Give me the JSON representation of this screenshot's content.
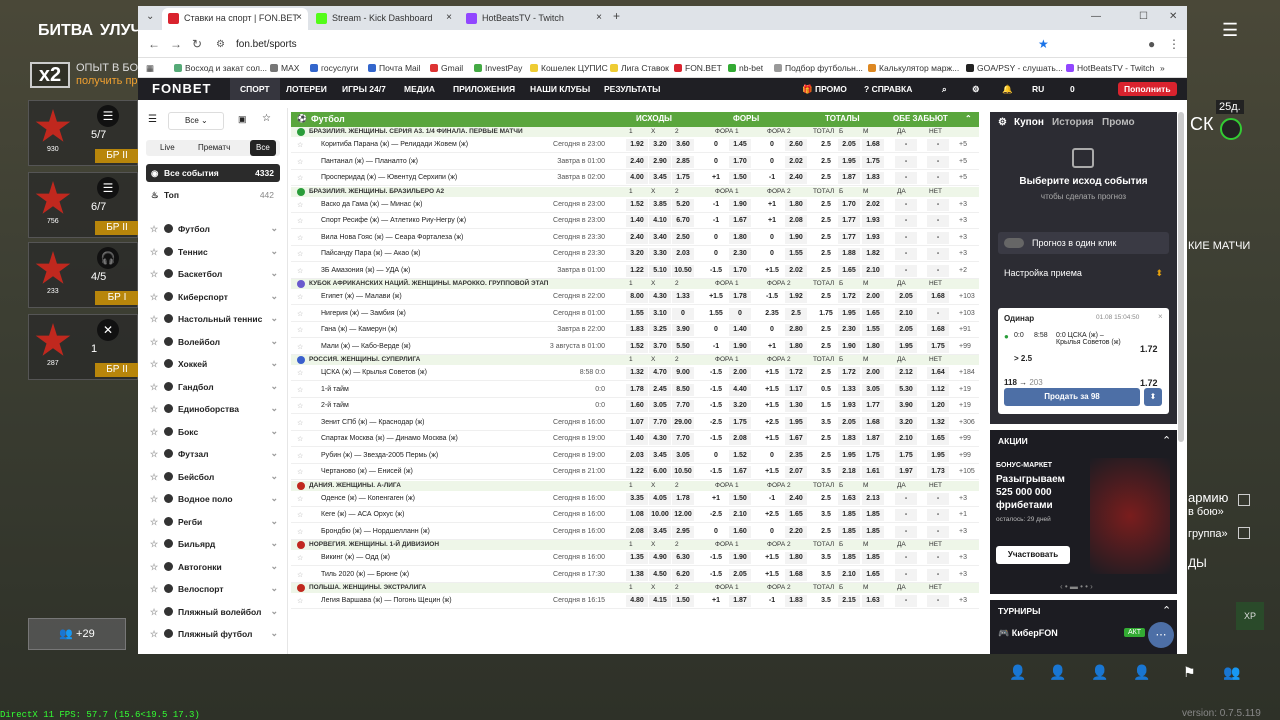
{
  "game": {
    "tab1": "БИТВА",
    "tab2": "УЛУЧ",
    "multiplier": "x2",
    "exp_line1": "ОПЫТ В БОЯ",
    "exp_line2": "получить про",
    "cards": [
      {
        "count": "5/7",
        "num": "930",
        "rank": "БР II",
        "icon": "☰"
      },
      {
        "count": "6/7",
        "num": "756",
        "rank": "БР II",
        "icon": "☰"
      },
      {
        "count": "4/5",
        "num": "233",
        "rank": "БР I",
        "icon": "🎧"
      },
      {
        "count": "1",
        "num": "287",
        "rank": "БР II",
        "icon": "✕"
      }
    ],
    "group": "+29",
    "fps": "DirectX 11 FPS: 57.7 (15.6<19.5 17.3)",
    "right": {
      "days": "25д.",
      "lbl1": "СК",
      "lbl2": "КИЕ МАТЧИ",
      "lbl3": "армию",
      "lbl4": "в бою»",
      "lbl5": "группа»",
      "lbl6": "ДЫ"
    },
    "version": "version: 0.7.5.119"
  },
  "browser": {
    "tabs": [
      "Ставки на спорт | FON.BET",
      "Stream - Kick Dashboard",
      "HotBeatsTV - Twitch"
    ],
    "url": "fon.bet/sports",
    "bookmarks": [
      "Восход и закат сол...",
      "MAX",
      "госуслуги",
      "Почта Mail",
      "Gmail",
      "InvestPay",
      "Кошелек ЦУПИС",
      "Лига Ставок",
      "FON.BET",
      "nb-bet",
      "Подбор футбольн...",
      "Калькулятор марж...",
      "GOA/PSY - слушать...",
      "HotBeatsTV - Twitch"
    ]
  },
  "fonbet": {
    "logo": "FONBET",
    "nav": [
      "СПОРТ",
      "ЛОТЕРЕИ",
      "ИГРЫ 24/7",
      "МЕДИА",
      "ПРИЛОЖЕНИЯ",
      "НАШИ КЛУБЫ",
      "РЕЗУЛЬТАТЫ"
    ],
    "promo": "ПРОМО",
    "help": "СПРАВКА",
    "lang": "RU",
    "balance": "0",
    "deposit": "Пополнить",
    "filter": "Все",
    "seg": [
      "Live",
      "Прематч",
      "Все"
    ],
    "all_events": "Все события",
    "all_count": "4332",
    "top": "Топ",
    "top_count": "442",
    "sports": [
      "Футбол",
      "Теннис",
      "Баскетбол",
      "Киберспорт",
      "Настольный теннис",
      "Волейбол",
      "Хоккей",
      "Гандбол",
      "Единоборства",
      "Бокс",
      "Футзал",
      "Бейсбол",
      "Водное поло",
      "Регби",
      "Бильярд",
      "Автогонки",
      "Велоспорт",
      "Пляжный волейбол",
      "Пляжный футбол"
    ],
    "header": {
      "title": "Футбол",
      "g1": "ИСХОДЫ",
      "g2": "ФОРЫ",
      "g3": "ТОТАЛЫ",
      "g4": "ОБЕ ЗАБЬЮТ"
    },
    "col_heads": [
      "1",
      "X",
      "2",
      "ФОРА 1",
      "ФОРА 2",
      "ТОТАЛ",
      "Б",
      "М",
      "ДА",
      "НЕТ"
    ]
  },
  "leagues": [
    {
      "name": "Бразилия. Женщины. Серия А3. 1/4 финала. Первые матчи",
      "flag": "#2a9d3a",
      "rows": [
        [
          "Коритиба Парана (ж) — Релидади Жовем (ж)",
          "Сегодня в 23:00",
          "1.92",
          "3.20",
          "3.60",
          "0",
          "1.45",
          "0",
          "2.60",
          "2.5",
          "2.05",
          "1.68",
          "-",
          "-",
          "+5"
        ],
        [
          "Пантанал (ж) — Планалто (ж)",
          "Завтра в 01:00",
          "2.40",
          "2.90",
          "2.85",
          "0",
          "1.70",
          "0",
          "2.02",
          "2.5",
          "1.95",
          "1.75",
          "-",
          "-",
          "+5"
        ],
        [
          "Просперидад (ж) — Ювентуд Серхипи (ж)",
          "Завтра в 02:00",
          "4.00",
          "3.45",
          "1.75",
          "+1",
          "1.50",
          "-1",
          "2.40",
          "2.5",
          "1.87",
          "1.83",
          "-",
          "-",
          "+5"
        ]
      ]
    },
    {
      "name": "Бразилия. Женщины. Бразильеро А2",
      "flag": "#2a9d3a",
      "rows": [
        [
          "Васко да Гама (ж) — Минас (ж)",
          "Сегодня в 23:00",
          "1.52",
          "3.85",
          "5.20",
          "-1",
          "1.90",
          "+1",
          "1.80",
          "2.5",
          "1.70",
          "2.02",
          "-",
          "-",
          "+3"
        ],
        [
          "Спорт Ресифе (ж) — Атлетико Риу-Негру (ж)",
          "Сегодня в 23:00",
          "1.40",
          "4.10",
          "6.70",
          "-1",
          "1.67",
          "+1",
          "2.08",
          "2.5",
          "1.77",
          "1.93",
          "-",
          "-",
          "+3"
        ],
        [
          "Вила Нова Гояс (ж) — Сеара Форталеза (ж)",
          "Сегодня в 23:30",
          "2.40",
          "3.40",
          "2.50",
          "0",
          "1.80",
          "0",
          "1.90",
          "2.5",
          "1.77",
          "1.93",
          "-",
          "-",
          "+3"
        ],
        [
          "Пайсанду Пара (ж) — Акао (ж)",
          "Сегодня в 23:30",
          "3.20",
          "3.30",
          "2.03",
          "0",
          "2.30",
          "0",
          "1.55",
          "2.5",
          "1.88",
          "1.82",
          "-",
          "-",
          "+3"
        ],
        [
          "3Б Амазония (ж) — УДА (ж)",
          "Завтра в 01:00",
          "1.22",
          "5.10",
          "10.50",
          "-1.5",
          "1.70",
          "+1.5",
          "2.02",
          "2.5",
          "1.65",
          "2.10",
          "-",
          "-",
          "+2"
        ]
      ]
    },
    {
      "name": "Кубок Африканских наций. Женщины. Марокко. Групповой этап",
      "flag": "#6a5acd",
      "rows": [
        [
          "Египет (ж) — Малави (ж)",
          "Сегодня в 22:00",
          "8.00",
          "4.30",
          "1.33",
          "+1.5",
          "1.78",
          "-1.5",
          "1.92",
          "2.5",
          "1.72",
          "2.00",
          "2.05",
          "1.68",
          "+103"
        ],
        [
          "Нигерия (ж) — Замбия (ж)",
          "Сегодня в 01:00",
          "1.55",
          "3.10",
          "0",
          "1.55",
          "0",
          "2.35",
          "2.5",
          "1.75",
          "1.95",
          "1.65",
          "2.10",
          "-",
          "+103"
        ],
        [
          "Гана (ж) — Камерун (ж)",
          "Завтра в 22:00",
          "1.83",
          "3.25",
          "3.90",
          "0",
          "1.40",
          "0",
          "2.80",
          "2.5",
          "2.30",
          "1.55",
          "2.05",
          "1.68",
          "+91"
        ],
        [
          "Мали (ж) — Кабо-Верде (ж)",
          "3 августа в 01:00",
          "1.52",
          "3.70",
          "5.50",
          "-1",
          "1.90",
          "+1",
          "1.80",
          "2.5",
          "1.90",
          "1.80",
          "1.95",
          "1.75",
          "+99"
        ]
      ]
    },
    {
      "name": "Россия. Женщины. Суперлига",
      "flag": "#3a5fcd",
      "rows": [
        [
          "ЦСКА (ж) — Крылья Советов (ж)",
          "8:58  0:0",
          "1.32",
          "4.70",
          "9.00",
          "-1.5",
          "2.00",
          "+1.5",
          "1.72",
          "2.5",
          "1.72",
          "2.00",
          "2.12",
          "1.64",
          "+184"
        ],
        [
          "1-й тайм",
          "0:0",
          "1.78",
          "2.45",
          "8.50",
          "-1.5",
          "4.40",
          "+1.5",
          "1.17",
          "0.5",
          "1.33",
          "3.05",
          "5.30",
          "1.12",
          "+19"
        ],
        [
          "2-й тайм",
          "0:0",
          "1.60",
          "3.05",
          "7.70",
          "-1.5",
          "3.20",
          "+1.5",
          "1.30",
          "1.5",
          "1.93",
          "1.77",
          "3.90",
          "1.20",
          "+19"
        ],
        [
          "Зенит СПб (ж) — Краснодар (ж)",
          "Сегодня в 16:00",
          "1.07",
          "7.70",
          "29.00",
          "-2.5",
          "1.75",
          "+2.5",
          "1.95",
          "3.5",
          "2.05",
          "1.68",
          "3.20",
          "1.32",
          "+306"
        ],
        [
          "Спартак Москва (ж) — Динамо Москва (ж)",
          "Сегодня в 19:00",
          "1.40",
          "4.30",
          "7.70",
          "-1.5",
          "2.08",
          "+1.5",
          "1.67",
          "2.5",
          "1.83",
          "1.87",
          "2.10",
          "1.65",
          "+99"
        ],
        [
          "Рубин (ж) — Звезда-2005 Пермь (ж)",
          "Сегодня в 19:00",
          "2.03",
          "3.45",
          "3.05",
          "0",
          "1.52",
          "0",
          "2.35",
          "2.5",
          "1.95",
          "1.75",
          "1.75",
          "1.95",
          "+99"
        ],
        [
          "Чертаново (ж) — Енисей (ж)",
          "Сегодня в 21:00",
          "1.22",
          "6.00",
          "10.50",
          "-1.5",
          "1.67",
          "+1.5",
          "2.07",
          "3.5",
          "2.18",
          "1.61",
          "1.97",
          "1.73",
          "+105"
        ]
      ]
    },
    {
      "name": "Дания. Женщины. А-Лига",
      "flag": "#c0281e",
      "rows": [
        [
          "Оденсе (ж) — Копенгаген (ж)",
          "Сегодня в 16:00",
          "3.35",
          "4.05",
          "1.78",
          "+1",
          "1.50",
          "-1",
          "2.40",
          "2.5",
          "1.63",
          "2.13",
          "-",
          "-",
          "+3"
        ],
        [
          "Кеге (ж) — АСА Орхус (ж)",
          "Сегодня в 16:00",
          "1.08",
          "10.00",
          "12.00",
          "-2.5",
          "2.10",
          "+2.5",
          "1.65",
          "3.5",
          "1.85",
          "1.85",
          "-",
          "-",
          "+1"
        ],
        [
          "Брондбю (ж) — Нордшелланн (ж)",
          "Сегодня в 16:00",
          "2.08",
          "3.45",
          "2.95",
          "0",
          "1.60",
          "0",
          "2.20",
          "2.5",
          "1.85",
          "1.85",
          "-",
          "-",
          "+3"
        ]
      ]
    },
    {
      "name": "Норвегия. Женщины. 1-й дивизион",
      "flag": "#c0281e",
      "rows": [
        [
          "Викинг (ж) — Одд (ж)",
          "Сегодня в 16:00",
          "1.35",
          "4.90",
          "6.30",
          "-1.5",
          "1.90",
          "+1.5",
          "1.80",
          "3.5",
          "1.85",
          "1.85",
          "-",
          "-",
          "+3"
        ],
        [
          "Тиль 2020 (ж) — Брюне (ж)",
          "Сегодня в 17:30",
          "1.38",
          "4.50",
          "6.20",
          "-1.5",
          "2.05",
          "+1.5",
          "1.68",
          "3.5",
          "2.10",
          "1.65",
          "-",
          "-",
          "+3"
        ]
      ]
    },
    {
      "name": "Польша. Женщины. Экстралига",
      "flag": "#c0281e",
      "rows": [
        [
          "Легия Варшава (ж) — Погонь Щецин (ж)",
          "Сегодня в 16:15",
          "4.80",
          "4.15",
          "1.50",
          "+1",
          "1.87",
          "-1",
          "1.83",
          "3.5",
          "2.15",
          "1.63",
          "-",
          "-",
          "+3"
        ]
      ]
    }
  ],
  "coupon": {
    "tabs": [
      "Купон",
      "История",
      "Промо"
    ],
    "empty_title": "Выберите исход события",
    "empty_sub": "чтобы сделать прогноз",
    "one_click": "Прогноз в один клик",
    "settings": "Настройка приема",
    "bet_type": "Одинар",
    "bet_time": "01.08 15:04:50",
    "score": "0:0",
    "clock": "8:58",
    "match": "0:0 ЦСКА (ж) – Крылья Советов (ж)",
    "pick": "> 2.5",
    "odd": "1.72",
    "stake_from": "118",
    "stake_to": "203",
    "total_odd": "1.72",
    "sell": "Продать за 98"
  },
  "akcii": {
    "title": "АКЦИИ",
    "badge": "БОНУС-МАРКЕТ",
    "h1": "Разыгрываем",
    "h2": "525 000 000",
    "h3": "фрибетами",
    "left": "осталось: 29 дней",
    "btn": "Участвовать"
  },
  "tournaments": {
    "title": "ТУРНИРЫ",
    "item": "КиберFON",
    "tag": "АКТ"
  }
}
